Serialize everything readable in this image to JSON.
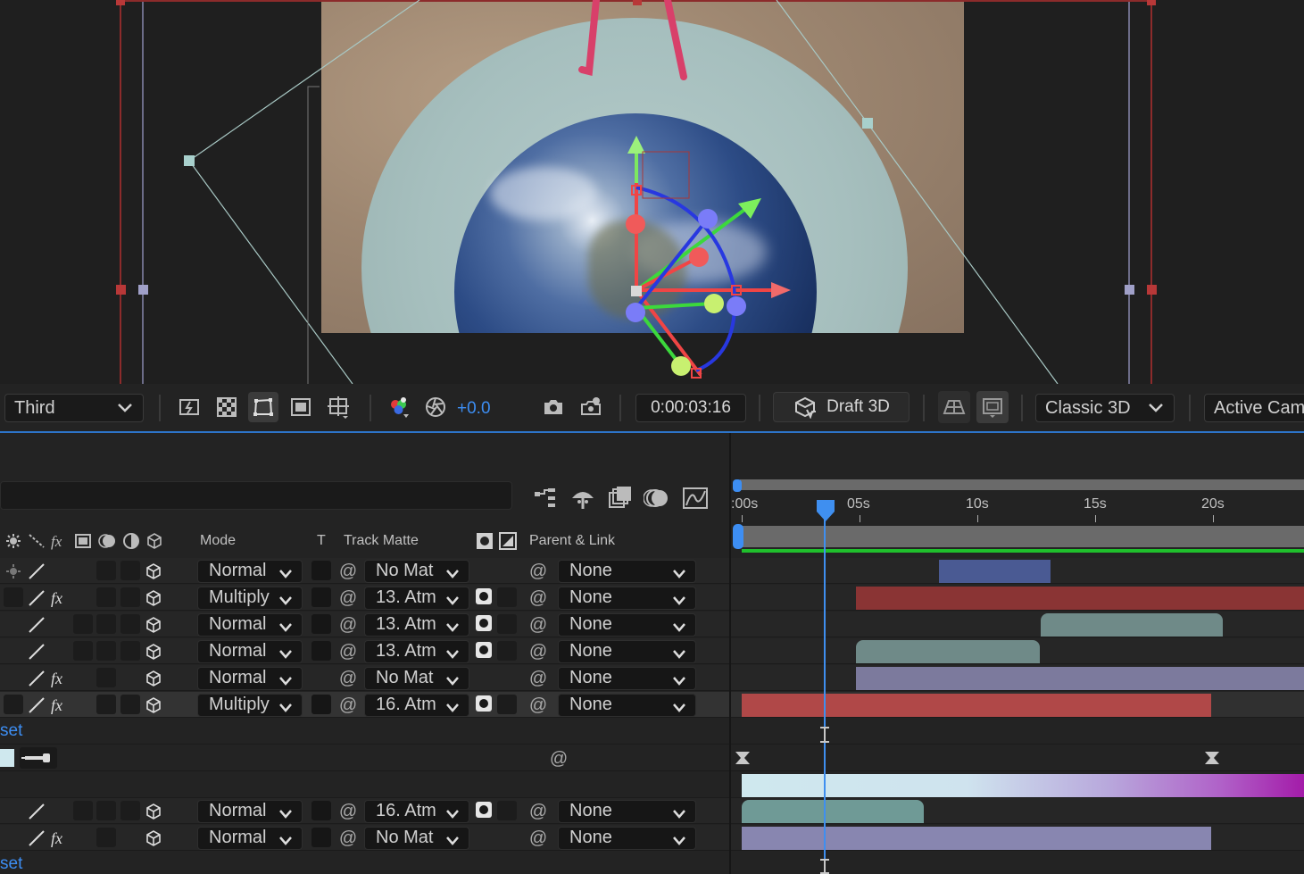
{
  "viewer": {
    "toolbar": {
      "view_layout": "Third",
      "exposure": "+0.0",
      "timecode": "0:00:03:16",
      "draft_3d": "Draft 3D",
      "renderer": "Classic 3D",
      "camera": "Active Cam"
    }
  },
  "timeline": {
    "columns": {
      "mode": "Mode",
      "t": "T",
      "track_matte": "Track Matte",
      "parent_link": "Parent & Link"
    },
    "ruler": {
      "labels": [
        ":00s",
        "05s",
        "10s",
        "15s",
        "20s"
      ]
    },
    "layers": [
      {
        "mode": "Normal",
        "matte": "No Mat",
        "parent": "None"
      },
      {
        "mode": "Multiply",
        "matte": "13. Atm",
        "parent": "None"
      },
      {
        "mode": "Normal",
        "matte": "13. Atm",
        "parent": "None"
      },
      {
        "mode": "Normal",
        "matte": "13. Atm",
        "parent": "None"
      },
      {
        "mode": "Normal",
        "matte": "No Mat",
        "parent": "None"
      },
      {
        "mode": "Multiply",
        "matte": "16. Atm",
        "parent": "None"
      },
      {
        "mode": "Normal",
        "matte": "16. Atm",
        "parent": "None"
      },
      {
        "mode": "Normal",
        "matte": "No Mat",
        "parent": "None"
      }
    ],
    "set_label_1": "set",
    "set_label_2": "set"
  },
  "colors": {
    "accent": "#3d8ef3",
    "playhead": "#3f8ff0",
    "bar_blue": "#4a5a93",
    "bar_red": "#8a3434",
    "bar_teal": "#6f8a88",
    "bar_lavender": "#7c7a9d",
    "bar_selected_red": "#b04848",
    "green_line": "#1fbf2c"
  }
}
